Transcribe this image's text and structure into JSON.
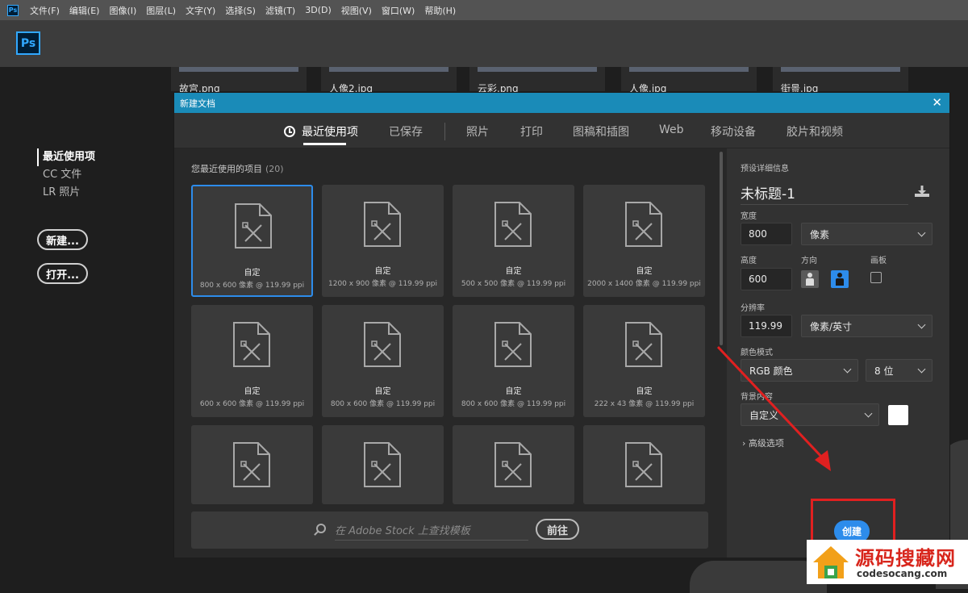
{
  "menubar": {
    "logo": "Ps",
    "items": [
      "文件(F)",
      "编辑(E)",
      "图像(I)",
      "图层(L)",
      "文字(Y)",
      "选择(S)",
      "滤镜(T)",
      "3D(D)",
      "视图(V)",
      "窗口(W)",
      "帮助(H)"
    ]
  },
  "app_logo": "Ps",
  "background_thumbs": [
    "故宫.png",
    "人像2.jpg",
    "云彩.png",
    "人像.jpg",
    "街景.jpg"
  ],
  "leftnav": {
    "items": [
      "最近使用项",
      "CC 文件",
      "LR 照片"
    ],
    "new_button": "新建...",
    "open_button": "打开..."
  },
  "dialog": {
    "title": "新建文档",
    "close": "✕",
    "tabs": [
      "最近使用项",
      "已保存",
      "照片",
      "打印",
      "图稿和插图",
      "Web",
      "移动设备",
      "胶片和视频"
    ],
    "section_title": "您最近使用的项目",
    "section_count": "(20)",
    "cards": [
      {
        "name": "自定",
        "sub": "800 x 600 像素 @ 119.99 ppi"
      },
      {
        "name": "自定",
        "sub": "1200 x 900 像素 @ 119.99 ppi"
      },
      {
        "name": "自定",
        "sub": "500 x 500 像素 @ 119.99 ppi"
      },
      {
        "name": "自定",
        "sub": "2000 x 1400 像素 @ 119.99 ppi"
      },
      {
        "name": "自定",
        "sub": "600 x 600 像素 @ 119.99 ppi"
      },
      {
        "name": "自定",
        "sub": "800 x 600 像素 @ 119.99 ppi"
      },
      {
        "name": "自定",
        "sub": "800 x 600 像素 @ 119.99 ppi"
      },
      {
        "name": "自定",
        "sub": "222 x 43 像素 @ 119.99 ppi"
      },
      {
        "name": "",
        "sub": ""
      },
      {
        "name": "",
        "sub": ""
      },
      {
        "name": "",
        "sub": ""
      },
      {
        "name": "",
        "sub": ""
      }
    ],
    "search_placeholder": "在 Adobe Stock 上查找模板",
    "goto_button": "前往",
    "preset": {
      "header": "预设详细信息",
      "doc_name": "未标题-1",
      "width_label": "宽度",
      "width_value": "800",
      "width_unit": "像素",
      "height_label": "高度",
      "height_value": "600",
      "orientation_label": "方向",
      "artboard_label": "画板",
      "resolution_label": "分辨率",
      "resolution_value": "119.99",
      "resolution_unit": "像素/英寸",
      "color_mode_label": "颜色模式",
      "color_mode_value": "RGB 颜色",
      "bit_depth_value": "8 位",
      "background_label": "背景内容",
      "background_value": "自定义",
      "advanced": "高级选项",
      "create_button": "创建"
    }
  },
  "watermark": {
    "text": "源码搜藏网",
    "url": "codesocang.com"
  },
  "colors": {
    "accent": "#2d8ceb",
    "titlebar": "#1a8bb8",
    "annotation": "#e02020"
  }
}
